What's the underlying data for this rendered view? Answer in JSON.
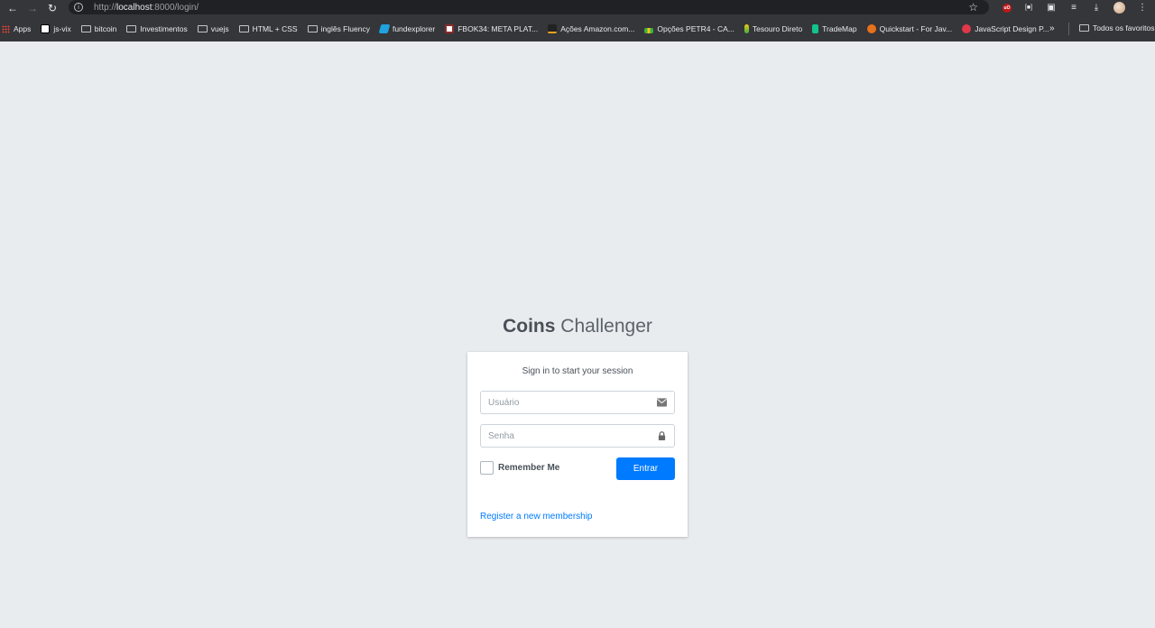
{
  "browser": {
    "url_prefix": "http://",
    "url_host": "localhost",
    "url_rest": ":8000/login/",
    "bookmarks": [
      {
        "label": "Apps",
        "icon": "apps-grid-icon"
      },
      {
        "label": "js-vix",
        "icon": "notion-icon"
      },
      {
        "label": "bitcoin",
        "icon": "folder-icon"
      },
      {
        "label": "Investimentos",
        "icon": "folder-icon"
      },
      {
        "label": "vuejs",
        "icon": "folder-icon"
      },
      {
        "label": "HTML + CSS",
        "icon": "folder-icon"
      },
      {
        "label": "inglês Fluency",
        "icon": "folder-icon"
      },
      {
        "label": "fundexplorer",
        "icon": "fundexplorer-icon"
      },
      {
        "label": "FBOK34: META PLAT...",
        "icon": "statusinvest-icon"
      },
      {
        "label": "Ações Amazon.com...",
        "icon": "investing-icon"
      },
      {
        "label": "Opções PETR4 - CA...",
        "icon": "chart-icon"
      },
      {
        "label": "Tesouro Direto",
        "icon": "tesouro-icon"
      },
      {
        "label": "TradeMap",
        "icon": "trademap-icon"
      },
      {
        "label": "Quickstart - For Jav...",
        "icon": "s-logo-icon"
      },
      {
        "label": "JavaScript Design P...",
        "icon": "d-logo-icon"
      }
    ],
    "all_bookmarks_label": "Todos os favoritos"
  },
  "login": {
    "logo_bold": "Coins",
    "logo_light": "Challenger",
    "message": "Sign in to start your session",
    "username_placeholder": "Usuário",
    "password_placeholder": "Senha",
    "remember_label": "Remember Me",
    "submit_label": "Entrar",
    "register_link": "Register a new membership"
  },
  "colors": {
    "page_background": "#e9ecef",
    "primary": "#007bff",
    "chrome": "#35363a"
  }
}
